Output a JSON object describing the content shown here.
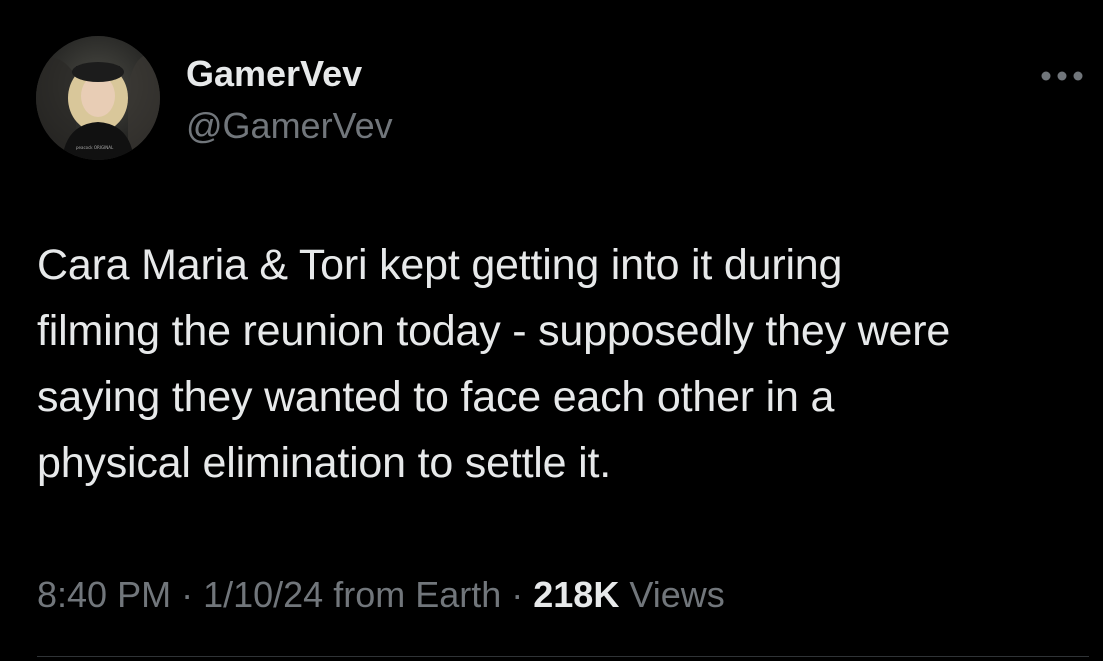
{
  "author": {
    "display_name": "GamerVev",
    "handle": "@GamerVev",
    "avatar_icon": "profile-photo",
    "avatar_badge_text": "peacock ORIGINAL"
  },
  "more_icon": "ellipsis-icon",
  "tweet": {
    "text": "Cara Maria & Tori kept getting into it during\nfilming the reunion today - supposedly they were\nsaying they wanted to face each other in a\nphysical elimination to settle it."
  },
  "meta": {
    "time": "8:40 PM",
    "separator": "·",
    "date": "1/10/24",
    "source": "from Earth",
    "views_count": "218K",
    "views_label": "Views"
  },
  "colors": {
    "background": "#000000",
    "primary_text": "#e7e9ea",
    "secondary_text": "#71767b",
    "divider": "#2f3336"
  }
}
